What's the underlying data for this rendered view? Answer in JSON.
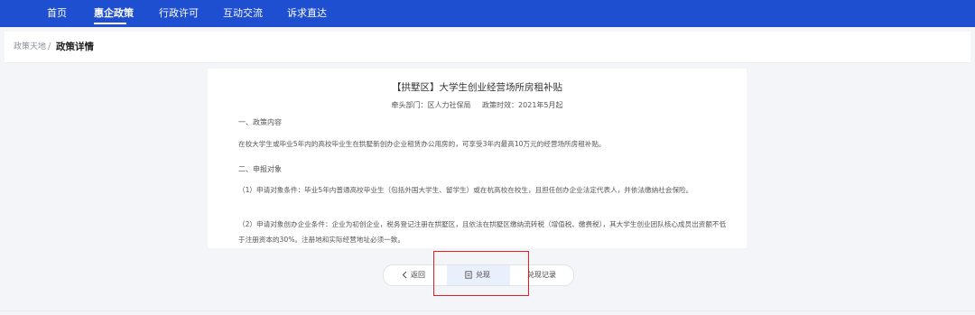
{
  "nav": {
    "items": [
      {
        "label": "首页"
      },
      {
        "label": "惠企政策"
      },
      {
        "label": "行政许可"
      },
      {
        "label": "互动交流"
      },
      {
        "label": "诉求直达"
      }
    ],
    "active": "惠企政策"
  },
  "breadcrumb": {
    "first": "政策天地",
    "separator": "/",
    "current": "政策详情"
  },
  "policy": {
    "title": "【拱墅区】大学生创业经营场所房租补贴",
    "dept_label": "牵头部门：区人力社保局",
    "validity_label": "政策时效：2021年5月起",
    "section1_heading": "一、政策内容",
    "section1_text": "在校大学生或毕业5年内的高校毕业生在拱墅新创办企业租赁办公用房的，可享受3年内最高10万元的经营场所房租补贴。",
    "section2_heading": "二、申报对象",
    "item1_text": "（1）申请对象条件：毕业5年内普通高校毕业生（包括外国大学生、留学生）或在杭高校在校生，且担任创办企业法定代表人，并依法缴纳社会保险。",
    "item2_text": "（2）申请对象创办企业条件：企业为初创企业，税务登记注册在拱墅区，且依法在拱墅区缴纳流转税（增值税、缴费税），其大学生创业团队核心成员出资额不低于注册资本的30%。注册地和实际经营地址必须一致。"
  },
  "actions": {
    "back_label": "返回",
    "back_icon": "chevron-left-icon",
    "redeem_label": "兑现",
    "redeem_icon": "document-icon",
    "record_label": "兑现记录"
  },
  "colors": {
    "nav_bg": "#1f4fd1",
    "page_bg": "#f4f5f8",
    "highlight_box": "#e02020"
  }
}
